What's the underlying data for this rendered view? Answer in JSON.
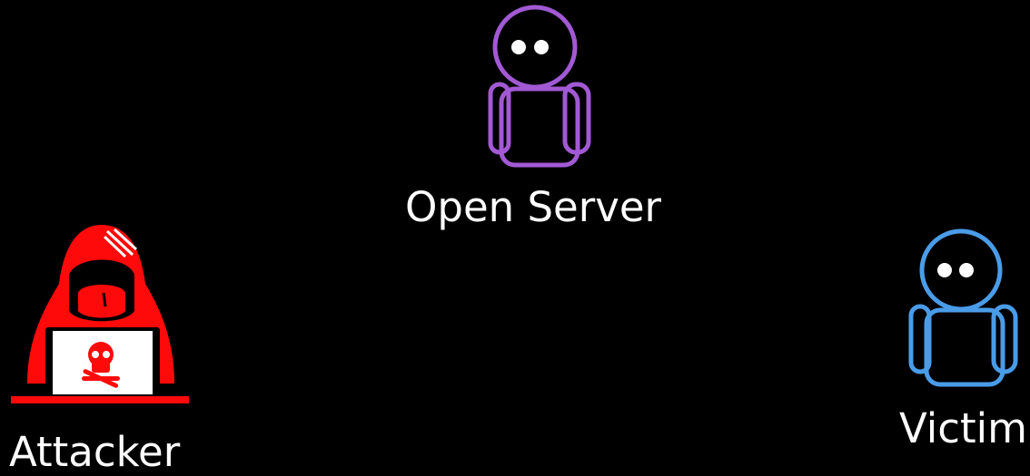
{
  "nodes": {
    "server": {
      "label": "Open Server",
      "color": "#a259d4",
      "icon": "robot-icon"
    },
    "attacker": {
      "label": "Attacker",
      "color": "#ff0a0a",
      "icon": "hacker-icon"
    },
    "victim": {
      "label": "Victim",
      "color": "#4a9ce8",
      "icon": "robot-icon"
    }
  }
}
